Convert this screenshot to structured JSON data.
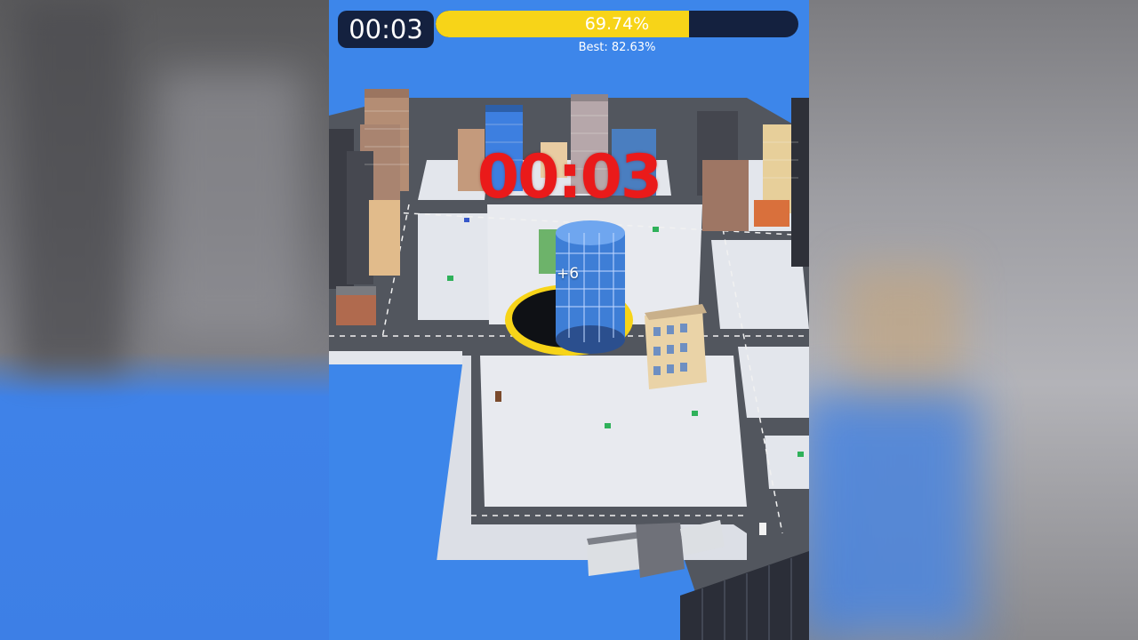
{
  "hud": {
    "timer": "00:03",
    "progress_label": "69.74%",
    "progress_value": 0.6974,
    "best_label": "Best: 82.63%"
  },
  "countdown": "00:03",
  "bonus": "+6",
  "colors": {
    "progress_fill": "#f7d418",
    "hud_background": "#14213f",
    "countdown_text": "#ea1a1a",
    "water": "#3d86ea",
    "hole_ring": "#f7d418"
  }
}
